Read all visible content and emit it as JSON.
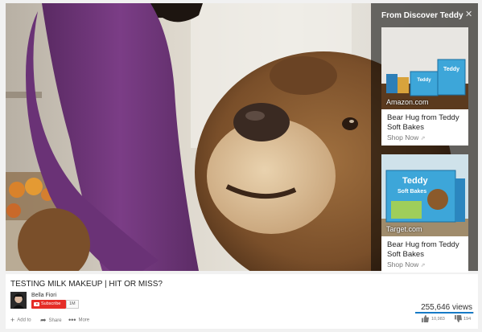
{
  "panel": {
    "title": "From Discover Teddy",
    "close_icon": "close-icon",
    "cards": [
      {
        "source": "Amazon.com",
        "title": "Bear Hug from Teddy Soft Bakes",
        "cta": "Shop Now"
      },
      {
        "source": "Target.com",
        "title": "Bear Hug from Teddy Soft Bakes",
        "cta": "Shop Now"
      }
    ]
  },
  "video": {
    "title": "TESTING MILK MAKEUP | HIT OR MISS?",
    "channel": "Bella Fiori",
    "subscribe_label": "Subscribe",
    "subscriber_count": "1M",
    "views": "255,646 views",
    "likes": "10,983",
    "dislikes": "194",
    "like_ratio": 0.98
  },
  "actions": {
    "add_to": "Add to",
    "share": "Share",
    "more": "More"
  },
  "product_art": {
    "teddy_text": "Teddy",
    "soft_bakes_text": "Soft Bakes"
  },
  "colors": {
    "subscribe_red": "#e52d27",
    "like_blue": "#167ac6",
    "panel_overlay": "rgba(0,0,0,0.55)"
  }
}
